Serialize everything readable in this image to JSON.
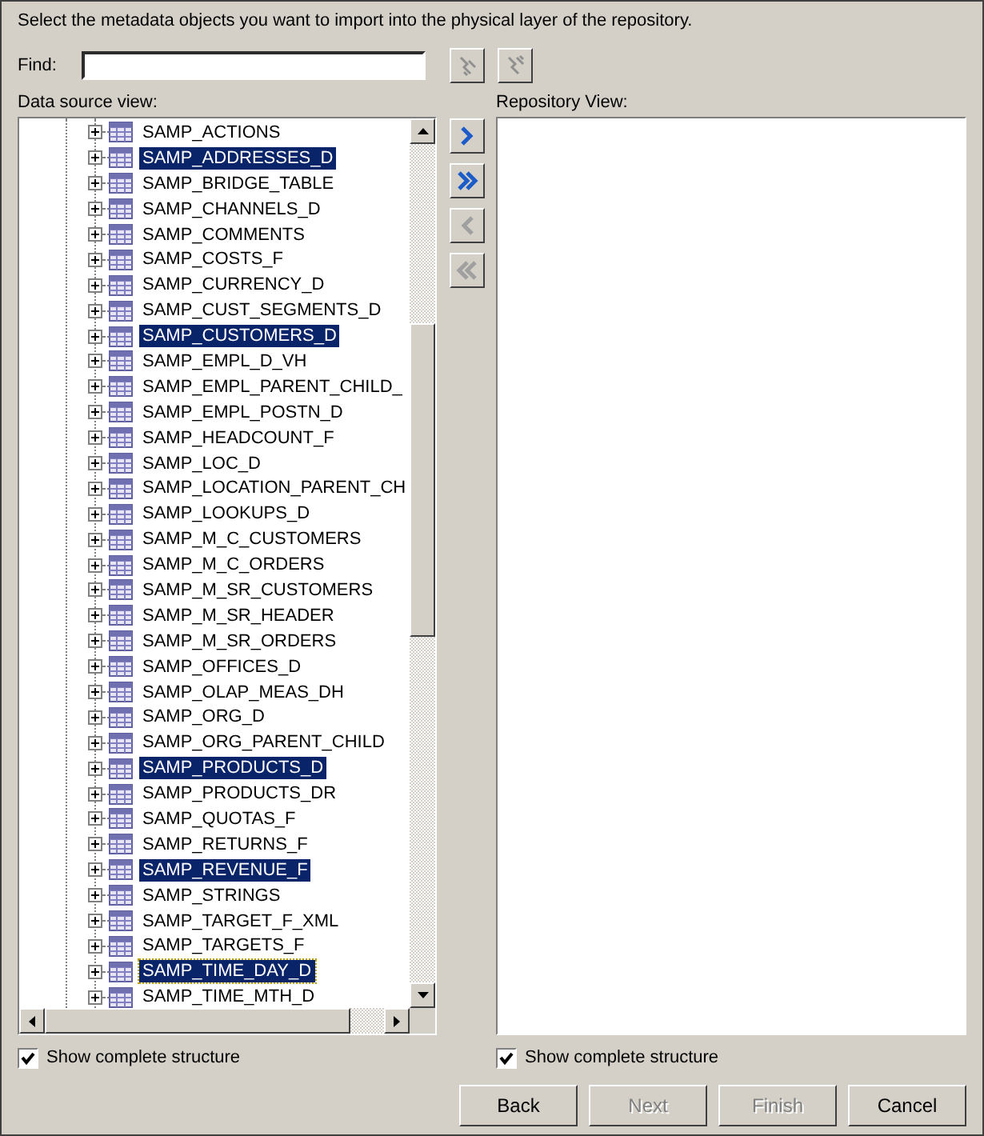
{
  "instruction": "Select the metadata objects you want to import into the physical layer of the repository.",
  "find": {
    "label": "Find:"
  },
  "find_buttons": [
    {
      "kind": "find-next",
      "disabled": true
    },
    {
      "kind": "find-all",
      "disabled": true
    }
  ],
  "data_source": {
    "label": "Data source view:",
    "tables": [
      {
        "name": "SAMP_ACTIONS",
        "selected": false,
        "focused": false
      },
      {
        "name": "SAMP_ADDRESSES_D",
        "selected": true,
        "focused": false
      },
      {
        "name": "SAMP_BRIDGE_TABLE",
        "selected": false,
        "focused": false
      },
      {
        "name": "SAMP_CHANNELS_D",
        "selected": false,
        "focused": false
      },
      {
        "name": "SAMP_COMMENTS",
        "selected": false,
        "focused": false
      },
      {
        "name": "SAMP_COSTS_F",
        "selected": false,
        "focused": false
      },
      {
        "name": "SAMP_CURRENCY_D",
        "selected": false,
        "focused": false
      },
      {
        "name": "SAMP_CUST_SEGMENTS_D",
        "selected": false,
        "focused": false
      },
      {
        "name": "SAMP_CUSTOMERS_D",
        "selected": true,
        "focused": false
      },
      {
        "name": "SAMP_EMPL_D_VH",
        "selected": false,
        "focused": false
      },
      {
        "name": "SAMP_EMPL_PARENT_CHILD_",
        "selected": false,
        "focused": false
      },
      {
        "name": "SAMP_EMPL_POSTN_D",
        "selected": false,
        "focused": false
      },
      {
        "name": "SAMP_HEADCOUNT_F",
        "selected": false,
        "focused": false
      },
      {
        "name": "SAMP_LOC_D",
        "selected": false,
        "focused": false
      },
      {
        "name": "SAMP_LOCATION_PARENT_CH",
        "selected": false,
        "focused": false
      },
      {
        "name": "SAMP_LOOKUPS_D",
        "selected": false,
        "focused": false
      },
      {
        "name": "SAMP_M_C_CUSTOMERS",
        "selected": false,
        "focused": false
      },
      {
        "name": "SAMP_M_C_ORDERS",
        "selected": false,
        "focused": false
      },
      {
        "name": "SAMP_M_SR_CUSTOMERS",
        "selected": false,
        "focused": false
      },
      {
        "name": "SAMP_M_SR_HEADER",
        "selected": false,
        "focused": false
      },
      {
        "name": "SAMP_M_SR_ORDERS",
        "selected": false,
        "focused": false
      },
      {
        "name": "SAMP_OFFICES_D",
        "selected": false,
        "focused": false
      },
      {
        "name": "SAMP_OLAP_MEAS_DH",
        "selected": false,
        "focused": false
      },
      {
        "name": "SAMP_ORG_D",
        "selected": false,
        "focused": false
      },
      {
        "name": "SAMP_ORG_PARENT_CHILD",
        "selected": false,
        "focused": false
      },
      {
        "name": "SAMP_PRODUCTS_D",
        "selected": true,
        "focused": false
      },
      {
        "name": "SAMP_PRODUCTS_DR",
        "selected": false,
        "focused": false
      },
      {
        "name": "SAMP_QUOTAS_F",
        "selected": false,
        "focused": false
      },
      {
        "name": "SAMP_RETURNS_F",
        "selected": false,
        "focused": false
      },
      {
        "name": "SAMP_REVENUE_F",
        "selected": true,
        "focused": false
      },
      {
        "name": "SAMP_STRINGS",
        "selected": false,
        "focused": false
      },
      {
        "name": "SAMP_TARGET_F_XML",
        "selected": false,
        "focused": false
      },
      {
        "name": "SAMP_TARGETS_F",
        "selected": false,
        "focused": false
      },
      {
        "name": "SAMP_TIME_DAY_D",
        "selected": true,
        "focused": true
      },
      {
        "name": "SAMP_TIME_MTH_D",
        "selected": false,
        "focused": false
      }
    ],
    "show_complete_structure": {
      "label": "Show complete structure",
      "checked": true
    }
  },
  "transfer_buttons": [
    {
      "kind": "add",
      "disabled": false
    },
    {
      "kind": "add-all",
      "disabled": false
    },
    {
      "kind": "remove",
      "disabled": true
    },
    {
      "kind": "remove-all",
      "disabled": true
    }
  ],
  "repository": {
    "label": "Repository View:",
    "show_complete_structure": {
      "label": "Show complete structure",
      "checked": true
    }
  },
  "buttons": [
    {
      "label": "Back",
      "disabled": false
    },
    {
      "label": "Next",
      "disabled": true
    },
    {
      "label": "Finish",
      "disabled": true
    },
    {
      "label": "Cancel",
      "disabled": false
    }
  ]
}
